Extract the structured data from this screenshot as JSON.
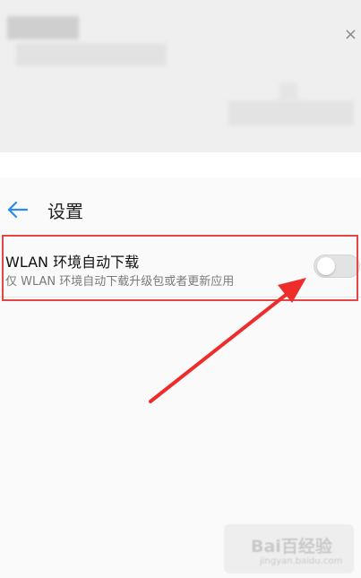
{
  "top_bar": {
    "close_glyph": "×"
  },
  "header": {
    "back_icon": "arrow-left-icon",
    "title": "设置"
  },
  "setting": {
    "title": "WLAN 环境自动下载",
    "description": "仅 WLAN 环境自动下载升级包或者更新应用",
    "toggle_state": "off"
  },
  "watermark": {
    "main": "Bai百经验",
    "sub": "jingyan.baidu.com"
  },
  "colors": {
    "accent_blue": "#2a8bf0",
    "highlight_red": "#e64545",
    "arrow_red": "#ee2c2c"
  }
}
